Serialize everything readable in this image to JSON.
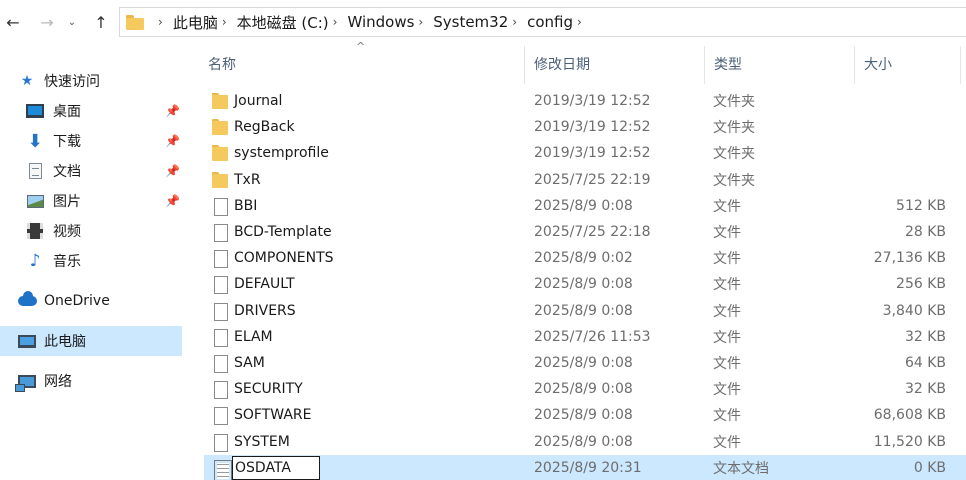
{
  "addressbar": {
    "back_icon": "arrow-left",
    "forward_icon": "arrow-right",
    "recent_icon": "chevron-down",
    "up_icon": "arrow-up",
    "back_glyph": "←",
    "forward_glyph": "→",
    "recent_glyph": "⌄",
    "up_glyph": "↑",
    "separator": "›",
    "breadcrumbs": [
      "此电脑",
      "本地磁盘 (C:)",
      "Windows",
      "System32",
      "config"
    ]
  },
  "navpane": {
    "pin_glyph": "📌",
    "items": [
      {
        "label": "快速访问",
        "icon": "star-icon"
      },
      {
        "label": "桌面",
        "icon": "desktop-icon",
        "pinned": true
      },
      {
        "label": "下载",
        "icon": "download-icon",
        "pinned": true
      },
      {
        "label": "文档",
        "icon": "document-icon",
        "pinned": true
      },
      {
        "label": "图片",
        "icon": "picture-icon",
        "pinned": true
      },
      {
        "label": "视频",
        "icon": "video-icon"
      },
      {
        "label": "音乐",
        "icon": "music-icon"
      },
      {
        "label": "OneDrive",
        "icon": "cloud-icon"
      },
      {
        "label": "此电脑",
        "icon": "computer-icon",
        "selected": true
      },
      {
        "label": "网络",
        "icon": "network-icon"
      }
    ]
  },
  "content": {
    "sort_indicator": "^",
    "columns": {
      "name": "名称",
      "date": "修改日期",
      "type": "类型",
      "size": "大小"
    },
    "files": [
      {
        "name": "Journal",
        "date": "2019/3/19 12:52",
        "type": "文件夹",
        "size": "",
        "kind": "folder"
      },
      {
        "name": "RegBack",
        "date": "2019/3/19 12:52",
        "type": "文件夹",
        "size": "",
        "kind": "folder"
      },
      {
        "name": "systemprofile",
        "date": "2019/3/19 12:52",
        "type": "文件夹",
        "size": "",
        "kind": "folder"
      },
      {
        "name": "TxR",
        "date": "2025/7/25 22:19",
        "type": "文件夹",
        "size": "",
        "kind": "folder"
      },
      {
        "name": "BBI",
        "date": "2025/8/9 0:08",
        "type": "文件",
        "size": "512 KB",
        "kind": "file"
      },
      {
        "name": "BCD-Template",
        "date": "2025/7/25 22:18",
        "type": "文件",
        "size": "28 KB",
        "kind": "file"
      },
      {
        "name": "COMPONENTS",
        "date": "2025/8/9 0:02",
        "type": "文件",
        "size": "27,136 KB",
        "kind": "file"
      },
      {
        "name": "DEFAULT",
        "date": "2025/8/9 0:08",
        "type": "文件",
        "size": "256 KB",
        "kind": "file"
      },
      {
        "name": "DRIVERS",
        "date": "2025/8/9 0:08",
        "type": "文件",
        "size": "3,840 KB",
        "kind": "file"
      },
      {
        "name": "ELAM",
        "date": "2025/7/26 11:53",
        "type": "文件",
        "size": "32 KB",
        "kind": "file"
      },
      {
        "name": "SAM",
        "date": "2025/8/9 0:08",
        "type": "文件",
        "size": "64 KB",
        "kind": "file"
      },
      {
        "name": "SECURITY",
        "date": "2025/8/9 0:08",
        "type": "文件",
        "size": "32 KB",
        "kind": "file"
      },
      {
        "name": "SOFTWARE",
        "date": "2025/8/9 0:08",
        "type": "文件",
        "size": "68,608 KB",
        "kind": "file"
      },
      {
        "name": "SYSTEM",
        "date": "2025/8/9 0:08",
        "type": "文件",
        "size": "11,520 KB",
        "kind": "file"
      },
      {
        "name": "OSDATA",
        "date": "2025/8/9 20:31",
        "type": "文本文档",
        "size": "0 KB",
        "kind": "txt",
        "selected": true,
        "renaming": true
      }
    ]
  }
}
